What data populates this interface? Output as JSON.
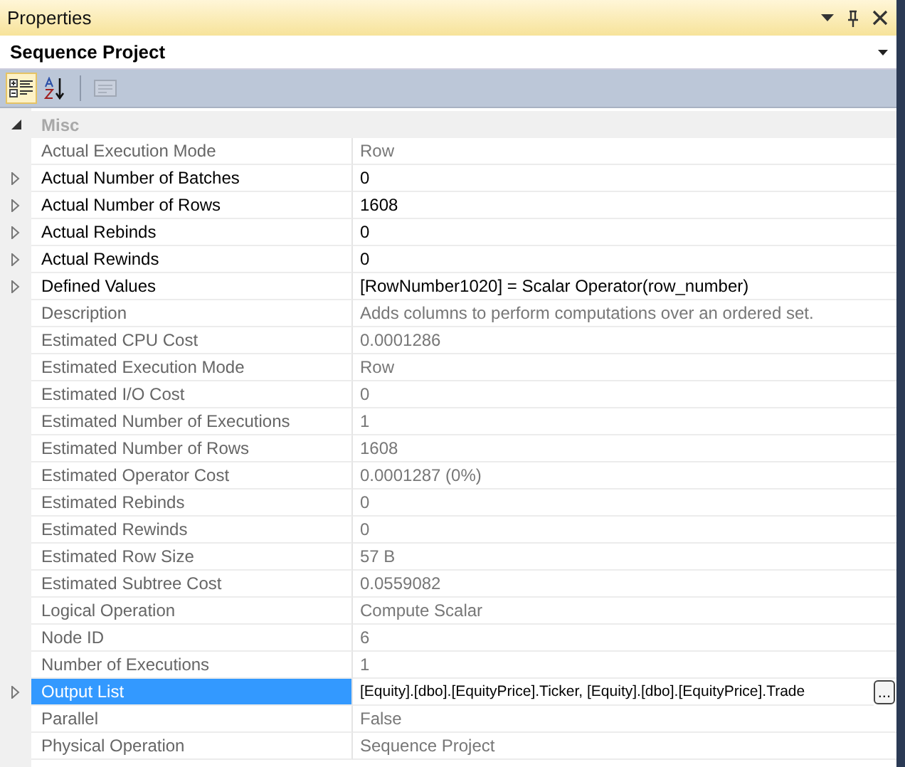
{
  "window": {
    "title": "Properties"
  },
  "object_selector": {
    "value": "Sequence Project"
  },
  "toolbar": [
    {
      "kind": "categorized",
      "selected": true,
      "disabled": false
    },
    {
      "kind": "alphabetical",
      "selected": false,
      "disabled": false
    },
    {
      "kind": "pages",
      "selected": false,
      "disabled": true
    }
  ],
  "category": {
    "name": "Misc",
    "expanded": true
  },
  "rows": [
    {
      "name": "Actual Execution Mode",
      "value": "Row",
      "expandable": false,
      "editable": false,
      "selected": false
    },
    {
      "name": "Actual Number of Batches",
      "value": "0",
      "expandable": true,
      "editable": true,
      "selected": false
    },
    {
      "name": "Actual Number of Rows",
      "value": "1608",
      "expandable": true,
      "editable": true,
      "selected": false
    },
    {
      "name": "Actual Rebinds",
      "value": "0",
      "expandable": true,
      "editable": true,
      "selected": false
    },
    {
      "name": "Actual Rewinds",
      "value": "0",
      "expandable": true,
      "editable": true,
      "selected": false
    },
    {
      "name": "Defined Values",
      "value": "[RowNumber1020] = Scalar Operator(row_number)",
      "expandable": true,
      "editable": true,
      "selected": false
    },
    {
      "name": "Description",
      "value": "Adds columns to perform computations over an ordered set.",
      "expandable": false,
      "editable": false,
      "selected": false
    },
    {
      "name": "Estimated CPU Cost",
      "value": "0.0001286",
      "expandable": false,
      "editable": false,
      "selected": false
    },
    {
      "name": "Estimated Execution Mode",
      "value": "Row",
      "expandable": false,
      "editable": false,
      "selected": false
    },
    {
      "name": "Estimated I/O Cost",
      "value": "0",
      "expandable": false,
      "editable": false,
      "selected": false
    },
    {
      "name": "Estimated Number of Executions",
      "value": "1",
      "expandable": false,
      "editable": false,
      "selected": false
    },
    {
      "name": "Estimated Number of Rows",
      "value": "1608",
      "expandable": false,
      "editable": false,
      "selected": false
    },
    {
      "name": "Estimated Operator Cost",
      "value": "0.0001287 (0%)",
      "expandable": false,
      "editable": false,
      "selected": false
    },
    {
      "name": "Estimated Rebinds",
      "value": "0",
      "expandable": false,
      "editable": false,
      "selected": false
    },
    {
      "name": "Estimated Rewinds",
      "value": "0",
      "expandable": false,
      "editable": false,
      "selected": false
    },
    {
      "name": "Estimated Row Size",
      "value": "57 B",
      "expandable": false,
      "editable": false,
      "selected": false
    },
    {
      "name": "Estimated Subtree Cost",
      "value": "0.0559082",
      "expandable": false,
      "editable": false,
      "selected": false
    },
    {
      "name": "Logical Operation",
      "value": "Compute Scalar",
      "expandable": false,
      "editable": false,
      "selected": false
    },
    {
      "name": "Node ID",
      "value": "6",
      "expandable": false,
      "editable": false,
      "selected": false
    },
    {
      "name": "Number of Executions",
      "value": "1",
      "expandable": false,
      "editable": false,
      "selected": false
    },
    {
      "name": "Output List",
      "value": "[Equity].[dbo].[EquityPrice].Ticker, [Equity].[dbo].[EquityPrice].Trade",
      "expandable": true,
      "editable": true,
      "selected": true,
      "ellipsis": "..."
    },
    {
      "name": "Parallel",
      "value": "False",
      "expandable": false,
      "editable": false,
      "selected": false
    },
    {
      "name": "Physical Operation",
      "value": "Sequence Project",
      "expandable": false,
      "editable": false,
      "selected": false
    }
  ]
}
